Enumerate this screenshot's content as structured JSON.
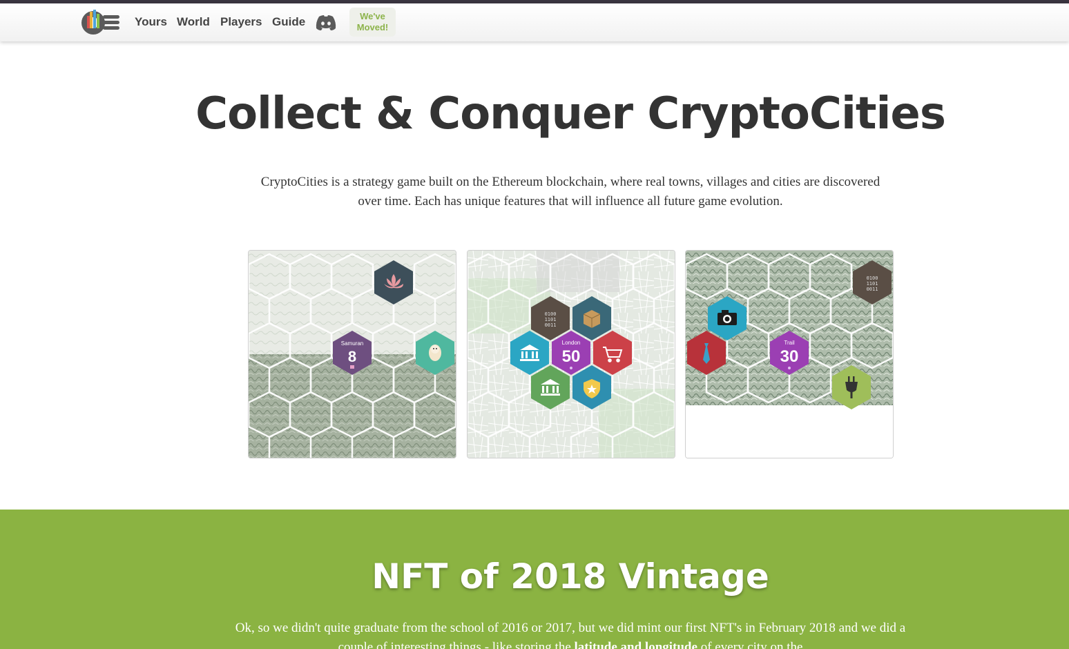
{
  "nav": {
    "items": [
      "Yours",
      "World",
      "Players",
      "Guide"
    ],
    "moved_line1": "We've",
    "moved_line2": "Moved!"
  },
  "hero": {
    "title": "Collect & Conquer CryptoCities",
    "text": "CryptoCities is a strategy game built on the Ethereum blockchain, where real towns, villages and cities are discovered over time. Each has unique features that will influence all future game evolution."
  },
  "cards": [
    {
      "city_name": "Samuran",
      "city_number": "8"
    },
    {
      "city_name": "London",
      "city_number": "50"
    },
    {
      "city_name": "Trail",
      "city_number": "30"
    }
  ],
  "binary_label": "0100 1101 0011",
  "nft": {
    "title": "NFT of 2018 Vintage",
    "text_before": "Ok, so we didn't quite graduate from the school of 2016 or 2017, but we did mint our first NFT's in February 2018 and we did a couple of interesting things - like storing the ",
    "text_bold": "latitude and longitude",
    "text_after": " of every city on the"
  },
  "colors": {
    "green_section": "#8bb342",
    "accent": "#8cb34a",
    "hex_purple_dark": "#6e4f80",
    "hex_purple": "#9b3fb3",
    "hex_teal": "#3a6878",
    "hex_cyan": "#2ba6c4",
    "hex_red": "#cc4148",
    "hex_green": "#62a55b",
    "hex_mint": "#4fb89f",
    "hex_brown": "#5a4e45",
    "hex_lime": "#9fbe5a"
  }
}
